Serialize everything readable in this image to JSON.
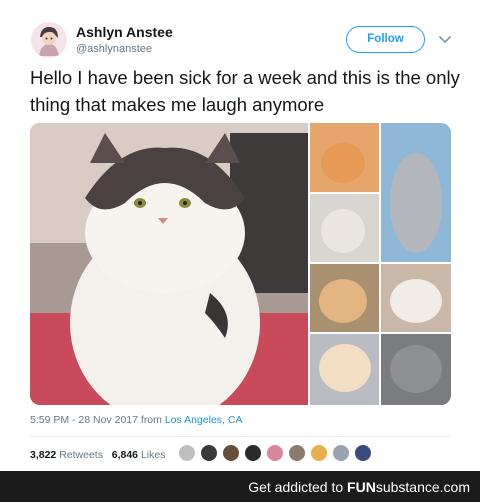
{
  "tweet": {
    "display_name": "Ashlyn Anstee",
    "handle": "@ashlynanstee",
    "follow_label": "Follow",
    "text": "Hello I have been sick for a week and this is the only thing that makes me laugh anymore",
    "timestamp": "5:59 PM - 28 Nov 2017 from ",
    "location": "Los Angeles, CA",
    "retweets_count": "3,822",
    "retweets_label": "Retweets",
    "likes_count": "6,846",
    "likes_label": "Likes"
  },
  "footer": {
    "prefix": "Get addicted to ",
    "brand_fun": "FUN",
    "brand_sub": "substance",
    "suffix": ".com"
  },
  "colors": {
    "accent": "#1da1f2",
    "link": "#1b95e0",
    "footer_bg": "#1b1b1b"
  },
  "icons": [
    "chevron-down-icon"
  ]
}
